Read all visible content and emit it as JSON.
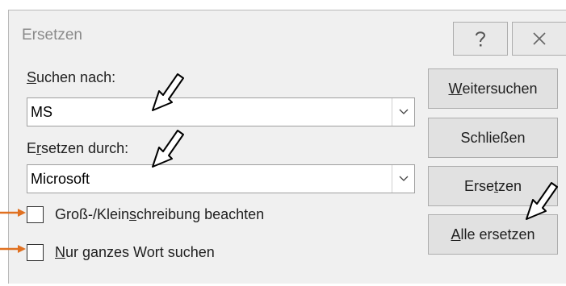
{
  "dialog": {
    "title": "Ersetzen",
    "help_icon": "help-icon",
    "close_icon": "close-icon"
  },
  "find": {
    "label_pre": "",
    "label_key": "S",
    "label_post": "uchen nach:",
    "value": "MS"
  },
  "replace": {
    "label_pre": "E",
    "label_key": "r",
    "label_post": "setzen durch:",
    "value": "Microsoft"
  },
  "options": {
    "match_case": {
      "pre": "Groß-/Klein",
      "key": "s",
      "post": "chreibung beachten",
      "checked": false
    },
    "whole_word": {
      "pre": "",
      "key": "N",
      "post": "ur ganzes Wort suchen",
      "checked": false
    }
  },
  "buttons": {
    "find_next": {
      "pre": "",
      "key": "W",
      "post": "eitersuchen"
    },
    "close": {
      "pre": "Schließen",
      "key": "",
      "post": ""
    },
    "replace": {
      "pre": "Erse",
      "key": "t",
      "post": "zen"
    },
    "replace_all": {
      "pre": "",
      "key": "A",
      "post": "lle ersetzen"
    }
  },
  "annotations": {
    "arrow_color": "#e07020",
    "pointer_color": "#000000"
  }
}
